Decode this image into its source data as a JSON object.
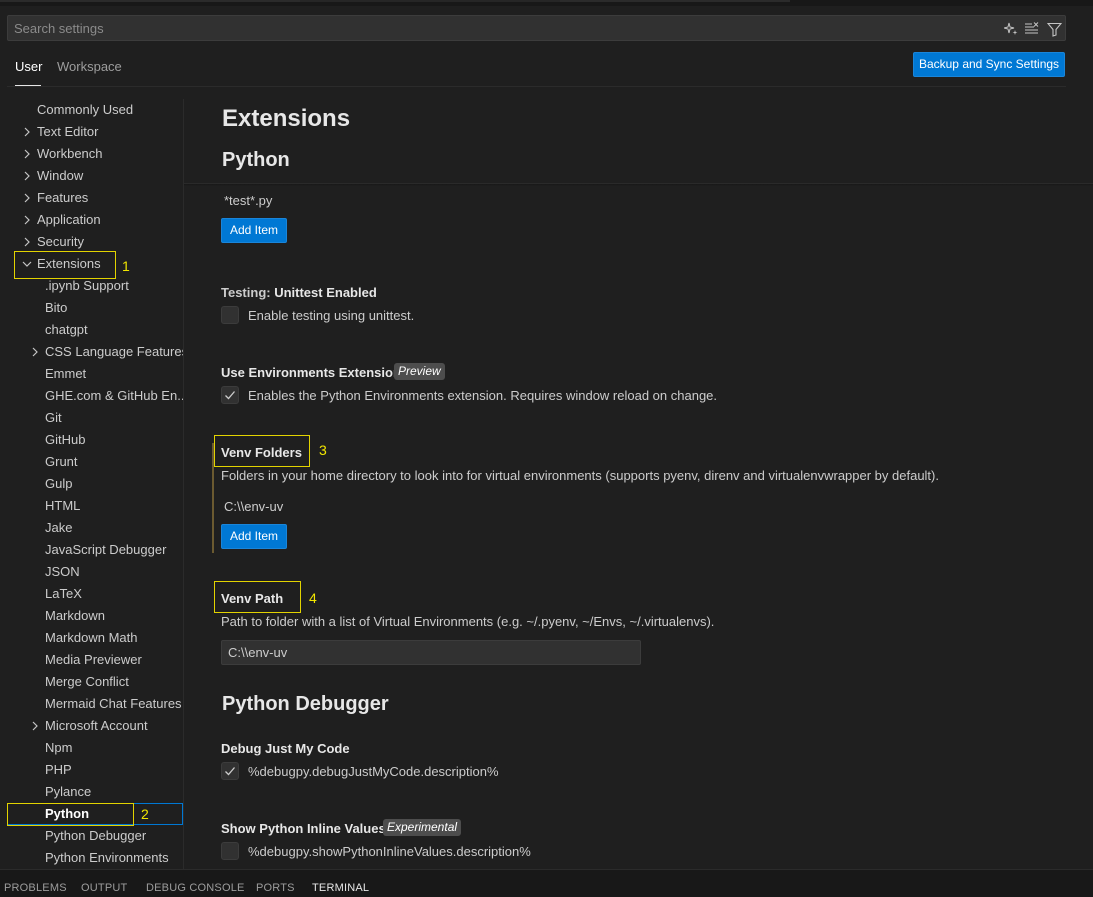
{
  "search": {
    "placeholder": "Search settings"
  },
  "tabs": [
    {
      "label": "User",
      "active": true
    },
    {
      "label": "Workspace",
      "active": false
    }
  ],
  "sync_button": "Backup and Sync Settings",
  "toc": [
    {
      "label": "Commonly Used"
    },
    {
      "label": "Text Editor"
    },
    {
      "label": "Workbench"
    },
    {
      "label": "Window"
    },
    {
      "label": "Features"
    },
    {
      "label": "Application"
    },
    {
      "label": "Security"
    },
    {
      "label": "Extensions"
    },
    {
      "label": ".ipynb Support"
    },
    {
      "label": "Bito"
    },
    {
      "label": "chatgpt"
    },
    {
      "label": "CSS Language Features"
    },
    {
      "label": "Emmet"
    },
    {
      "label": "GHE.com & GitHub En..."
    },
    {
      "label": "Git"
    },
    {
      "label": "GitHub"
    },
    {
      "label": "Grunt"
    },
    {
      "label": "Gulp"
    },
    {
      "label": "HTML"
    },
    {
      "label": "Jake"
    },
    {
      "label": "JavaScript Debugger"
    },
    {
      "label": "JSON"
    },
    {
      "label": "LaTeX"
    },
    {
      "label": "Markdown"
    },
    {
      "label": "Markdown Math"
    },
    {
      "label": "Media Previewer"
    },
    {
      "label": "Merge Conflict"
    },
    {
      "label": "Mermaid Chat Features"
    },
    {
      "label": "Microsoft Account"
    },
    {
      "label": "Npm"
    },
    {
      "label": "PHP"
    },
    {
      "label": "Pylance"
    },
    {
      "label": "Python"
    },
    {
      "label": "Python Debugger"
    },
    {
      "label": "Python Environments"
    }
  ],
  "annotations": [
    "1",
    "2",
    "3",
    "4"
  ],
  "content": {
    "heading": "Extensions",
    "subheading": "Python",
    "test_pattern": "*test*.py",
    "add_item": "Add Item",
    "unittest": {
      "category": "Testing: ",
      "name": "Unittest Enabled",
      "description": "Enable testing using unittest."
    },
    "env_ext": {
      "title": "Use Environments Extension",
      "badge": "Preview",
      "description": "Enables the Python Environments extension. Requires window reload on change."
    },
    "venv_folders": {
      "title": "Venv Folders",
      "description": "Folders in your home directory to look into for virtual environments (supports pyenv, direnv and virtualenvwrapper by default).",
      "value": "C:\\\\env-uv"
    },
    "venv_path": {
      "title": "Venv Path",
      "description": "Path to folder with a list of Virtual Environments (e.g. ~/.pyenv, ~/Envs, ~/.virtualenvs).",
      "value": "C:\\\\env-uv"
    },
    "debugger_heading": "Python Debugger",
    "just_my_code": {
      "title": "Debug Just My Code",
      "description": "%debugpy.debugJustMyCode.description%"
    },
    "inline_values": {
      "title": "Show Python Inline Values",
      "badge": "Experimental",
      "description": "%debugpy.showPythonInlineValues.description%"
    }
  },
  "panel_tabs": [
    "PROBLEMS",
    "OUTPUT",
    "DEBUG CONSOLE",
    "PORTS",
    "TERMINAL"
  ],
  "colors": {
    "accent": "#0078d4",
    "annotation": "#e2d300",
    "background": "#1f1f1f"
  }
}
